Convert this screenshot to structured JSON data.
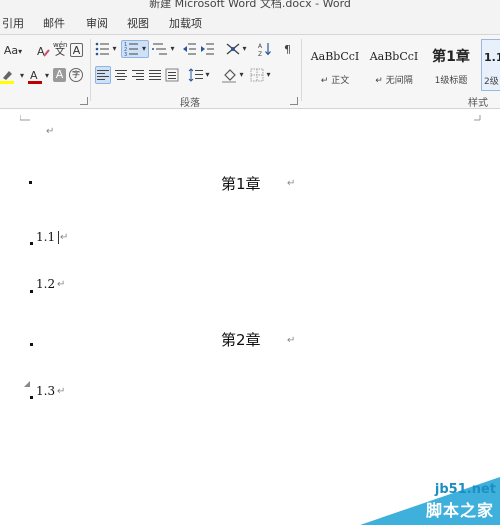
{
  "window": {
    "title": "新建 Microsoft Word 文档.docx - Word"
  },
  "tabs": [
    {
      "label": "引用"
    },
    {
      "label": "邮件"
    },
    {
      "label": "审阅"
    },
    {
      "label": "视图"
    },
    {
      "label": "加载项"
    }
  ],
  "ribbon": {
    "font": {
      "change_case_label": "Aa",
      "phonetic_label": "wén",
      "char_border_label": "A",
      "shade_label": "A",
      "enclose_label": "字"
    },
    "paragraph": {
      "group_label": "段落"
    },
    "styles": {
      "group_label": "样式",
      "items": [
        {
          "sample": "AaBbCcI",
          "name": "正文",
          "mark": "↵"
        },
        {
          "sample": "AaBbCcI",
          "name": "无间隔",
          "mark": "↵"
        },
        {
          "sample": "第1章",
          "name": "1级标题",
          "mark": ""
        },
        {
          "sample": "1.1",
          "name": "2级",
          "mark": ""
        }
      ]
    }
  },
  "document": {
    "blocks": [
      {
        "kind": "heading",
        "text": "第1章"
      },
      {
        "kind": "item",
        "text": "1.1"
      },
      {
        "kind": "item",
        "text": "1.2"
      },
      {
        "kind": "heading",
        "text": "第2章"
      },
      {
        "kind": "item",
        "text": "1.3"
      }
    ],
    "paragraph_mark": "↵"
  },
  "watermark": {
    "url": "jb51.net",
    "name": "脚本之家"
  },
  "colors": {
    "accent": "#2b579a",
    "highlight": "#ffff00",
    "font_color": "#c00000",
    "watermark": "#2aa6d8"
  }
}
